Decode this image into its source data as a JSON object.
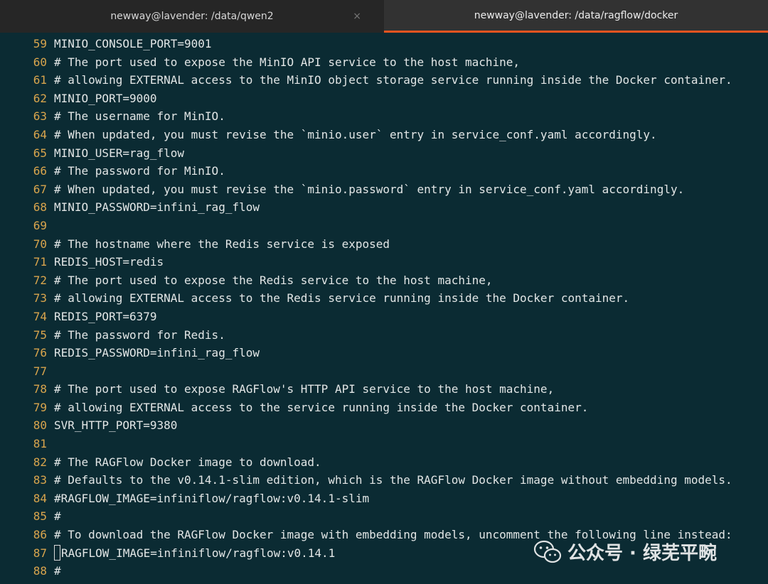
{
  "tabs": [
    {
      "title": "newway@lavender: /data/qwen2",
      "active": false
    },
    {
      "title": "newway@lavender: /data/ragflow/docker",
      "active": true
    }
  ],
  "close_icon": "×",
  "editor": {
    "lines": [
      {
        "n": "59",
        "text": "MINIO_CONSOLE_PORT=9001"
      },
      {
        "n": "60",
        "text": "# The port used to expose the MinIO API service to the host machine,"
      },
      {
        "n": "61",
        "text": "# allowing EXTERNAL access to the MinIO object storage service running inside the Docker container."
      },
      {
        "n": "62",
        "text": "MINIO_PORT=9000"
      },
      {
        "n": "63",
        "text": "# The username for MinIO."
      },
      {
        "n": "64",
        "text": "# When updated, you must revise the `minio.user` entry in service_conf.yaml accordingly."
      },
      {
        "n": "65",
        "text": "MINIO_USER=rag_flow"
      },
      {
        "n": "66",
        "text": "# The password for MinIO."
      },
      {
        "n": "67",
        "text": "# When updated, you must revise the `minio.password` entry in service_conf.yaml accordingly."
      },
      {
        "n": "68",
        "text": "MINIO_PASSWORD=infini_rag_flow"
      },
      {
        "n": "69",
        "text": ""
      },
      {
        "n": "70",
        "text": "# The hostname where the Redis service is exposed"
      },
      {
        "n": "71",
        "text": "REDIS_HOST=redis"
      },
      {
        "n": "72",
        "text": "# The port used to expose the Redis service to the host machine,"
      },
      {
        "n": "73",
        "text": "# allowing EXTERNAL access to the Redis service running inside the Docker container."
      },
      {
        "n": "74",
        "text": "REDIS_PORT=6379"
      },
      {
        "n": "75",
        "text": "# The password for Redis."
      },
      {
        "n": "76",
        "text": "REDIS_PASSWORD=infini_rag_flow"
      },
      {
        "n": "77",
        "text": ""
      },
      {
        "n": "78",
        "text": "# The port used to expose RAGFlow's HTTP API service to the host machine,"
      },
      {
        "n": "79",
        "text": "# allowing EXTERNAL access to the service running inside the Docker container."
      },
      {
        "n": "80",
        "text": "SVR_HTTP_PORT=9380"
      },
      {
        "n": "81",
        "text": ""
      },
      {
        "n": "82",
        "text": "# The RAGFlow Docker image to download."
      },
      {
        "n": "83",
        "text": "# Defaults to the v0.14.1-slim edition, which is the RAGFlow Docker image without embedding models."
      },
      {
        "n": "84",
        "text": "#RAGFLOW_IMAGE=infiniflow/ragflow:v0.14.1-slim"
      },
      {
        "n": "85",
        "text": "#"
      },
      {
        "n": "86",
        "text": "# To download the RAGFlow Docker image with embedding models, uncomment the following line instead:"
      },
      {
        "n": "87",
        "text": "RAGFLOW_IMAGE=infiniflow/ragflow:v0.14.1",
        "cursor": true
      },
      {
        "n": "88",
        "text": "#"
      }
    ]
  },
  "watermark": {
    "text": "公众号 · 绿芜平畹",
    "icon": "wechat-icon"
  },
  "colors": {
    "background": "#0b2b33",
    "line_number": "#d9a54d",
    "text": "#e2e6e6",
    "active_tab_accent": "#e95420"
  }
}
